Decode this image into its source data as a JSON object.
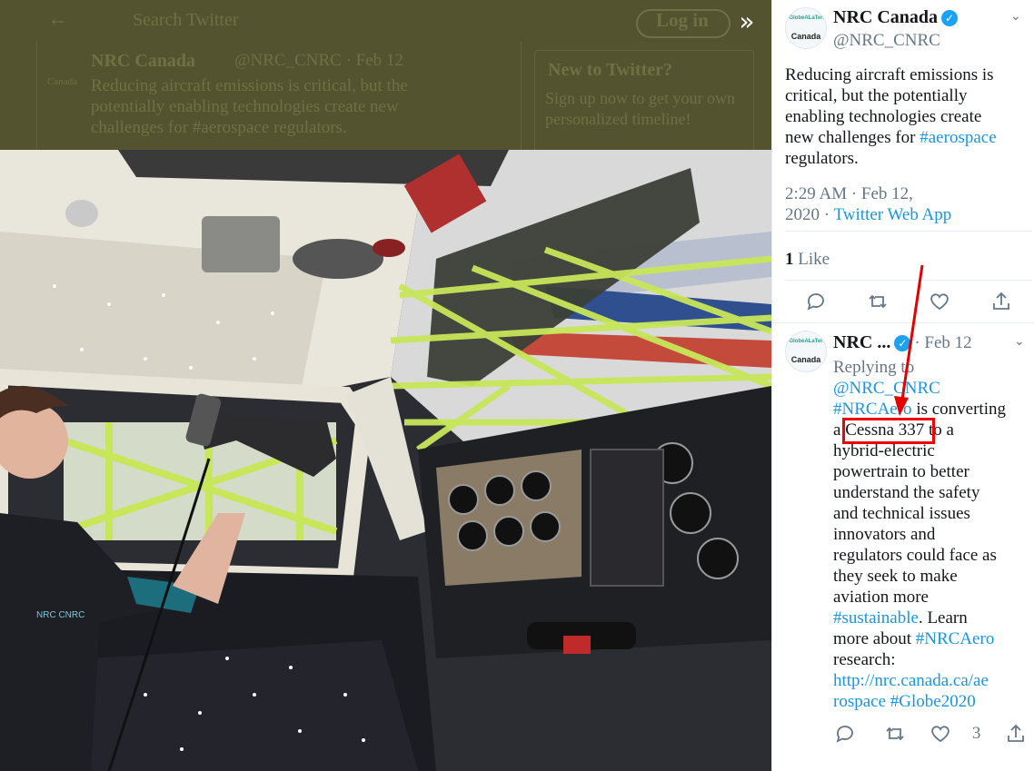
{
  "background": {
    "search_placeholder": "Search Twitter",
    "login_label": "Log in",
    "tweet_name": "NRC Canada",
    "tweet_handle_date": "@NRC_CNRC · Feb 12",
    "tweet_line1": "Reducing aircraft emissions is critical, but the",
    "tweet_line2": "potentially enabling technologies create new",
    "tweet_line3": "challenges for #aerospace regulators.",
    "panel_title": "New to Twitter?",
    "panel_line1": "Sign up now to get your own",
    "panel_line2": "personalized timeline!",
    "avatar_caption": "Canada"
  },
  "main_tweet": {
    "name": "NRC Canada",
    "handle": "@NRC_CNRC",
    "text_line1": "Reducing aircraft emissions is",
    "text_line2": "critical, but the potentially",
    "text_line3": "enabling technologies create",
    "text_line4_prefix": "new challenges for ",
    "hashtag": "#aerospace",
    "text_line5": "regulators.",
    "timestamp_line1": "2:29 AM · Feb 12,",
    "timestamp_line2_prefix": "2020 · ",
    "source": "Twitter Web App",
    "like_count": "1",
    "like_label": " Like",
    "avatar_caption_top": "#GlobeALaTerre",
    "avatar_caption_bottom": "Canada"
  },
  "reply_tweet": {
    "name": "NRC ...",
    "date": "· Feb 12",
    "replying_to_label": "Replying to",
    "replying_to_handle": "@NRC_CNRC",
    "lines": [
      {
        "pre": "",
        "link": "#NRCAero",
        "post": " is converting"
      },
      {
        "pre": "a ",
        "link": "",
        "post": "Cessna 337 to a"
      },
      {
        "pre": "hybrid-electric",
        "link": "",
        "post": ""
      },
      {
        "pre": "powertrain to better",
        "link": "",
        "post": ""
      },
      {
        "pre": "understand the safety",
        "link": "",
        "post": ""
      },
      {
        "pre": "and technical issues",
        "link": "",
        "post": ""
      },
      {
        "pre": "innovators and",
        "link": "",
        "post": ""
      },
      {
        "pre": "regulators could face as",
        "link": "",
        "post": ""
      },
      {
        "pre": "they seek to make",
        "link": "",
        "post": ""
      },
      {
        "pre": "aviation more",
        "link": "",
        "post": ""
      },
      {
        "pre": "",
        "link": "#sustainable",
        "post": ". Learn"
      },
      {
        "pre": "more about ",
        "link": "#NRCAero",
        "post": ""
      },
      {
        "pre": "research:",
        "link": "",
        "post": ""
      },
      {
        "pre": "",
        "link": "http://nrc.canada.ca/ae",
        "post": ""
      },
      {
        "pre": "",
        "link": "rospace #Globe2020",
        "post": ""
      }
    ],
    "like_count": "3",
    "avatar_caption_top": "#GlobeALaTerre",
    "avatar_caption_bottom": "Canada"
  },
  "colors": {
    "link": "#1b95e0",
    "verified": "#1da1f2",
    "annotation": "#e00000"
  },
  "icons": [
    "expand-icon",
    "verified-icon",
    "reply-icon",
    "retweet-icon",
    "like-icon",
    "share-icon",
    "chevron-down-icon"
  ]
}
